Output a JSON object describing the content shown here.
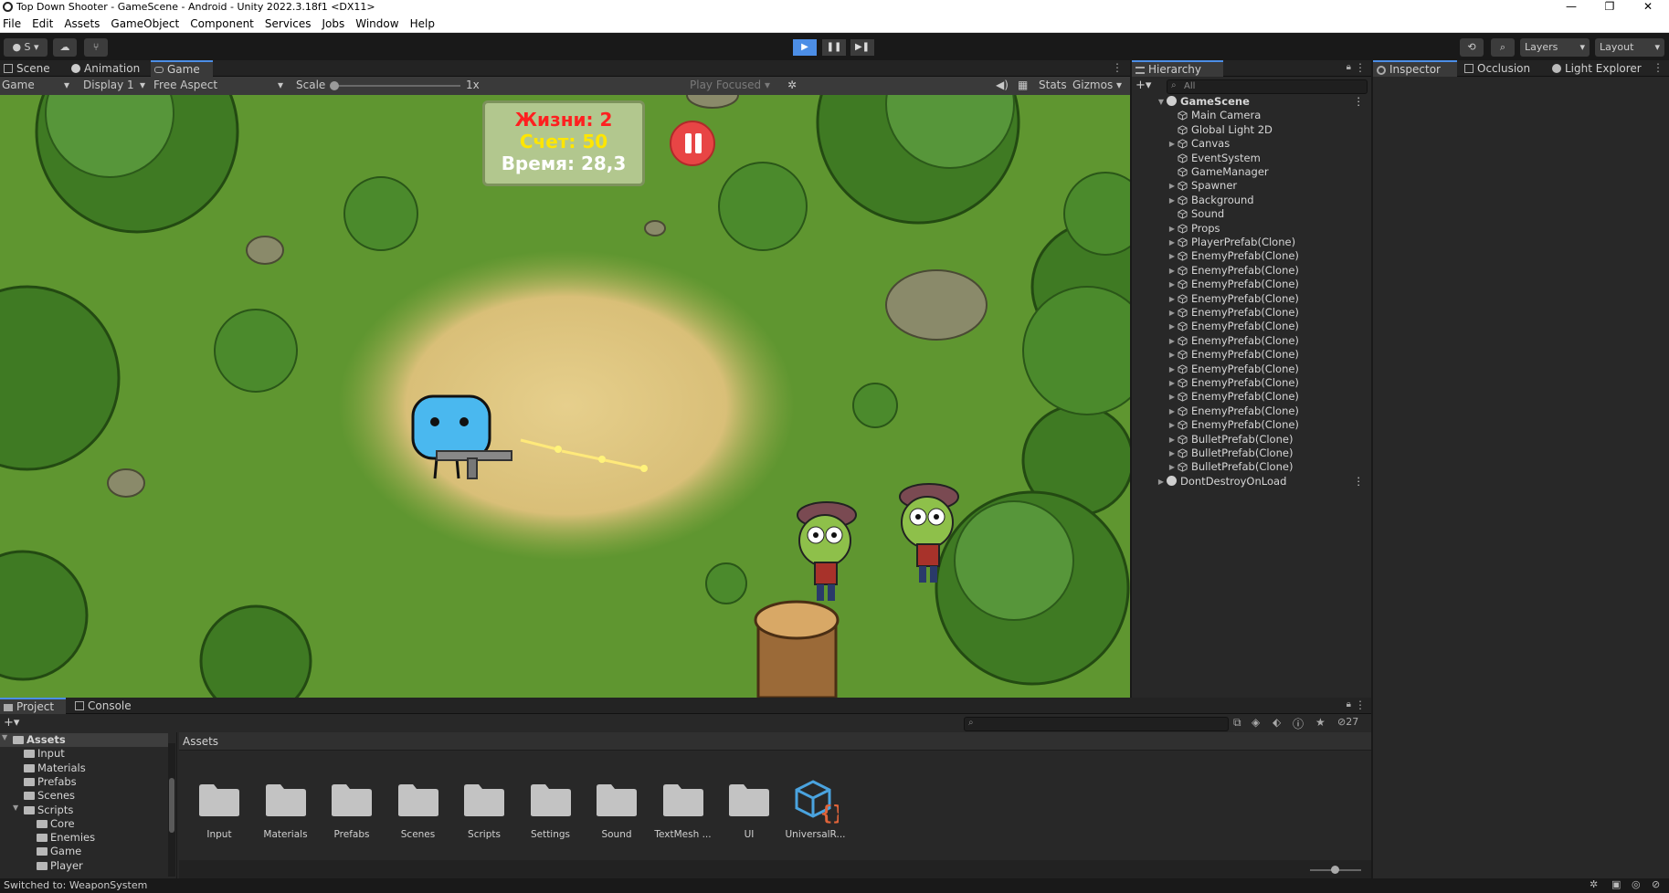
{
  "window": {
    "title": "Top Down Shooter - GameScene - Android - Unity 2022.3.18f1 <DX11>",
    "controls": [
      "—",
      "❐",
      "✕"
    ]
  },
  "menu": [
    "File",
    "Edit",
    "Assets",
    "GameObject",
    "Component",
    "Services",
    "Jobs",
    "Window",
    "Help"
  ],
  "toolbar": {
    "account_label": "S",
    "layers_label": "Layers",
    "layout_label": "Layout"
  },
  "scene_tabs": [
    "Scene",
    "Animation",
    "Game"
  ],
  "game_bar": {
    "mode": "Game",
    "display": "Display 1",
    "aspect": "Free Aspect",
    "scale_label": "Scale",
    "scale_value": "1x",
    "play_focused": "Play Focused",
    "stats": "Stats",
    "gizmos": "Gizmos"
  },
  "hud": {
    "lives": "Жизни: 2",
    "score": "Счет: 50",
    "time": "Время: 28,3"
  },
  "hierarchy": {
    "tab": "Hierarchy",
    "search_placeholder": "All",
    "scene": "GameScene",
    "items": [
      {
        "label": "Main Camera",
        "expandable": false
      },
      {
        "label": "Global Light 2D",
        "expandable": false
      },
      {
        "label": "Canvas",
        "expandable": true
      },
      {
        "label": "EventSystem",
        "expandable": false
      },
      {
        "label": "GameManager",
        "expandable": false
      },
      {
        "label": "Spawner",
        "expandable": true
      },
      {
        "label": "Background",
        "expandable": true
      },
      {
        "label": "Sound",
        "expandable": false
      },
      {
        "label": "Props",
        "expandable": true
      },
      {
        "label": "PlayerPrefab(Clone)",
        "expandable": true
      },
      {
        "label": "EnemyPrefab(Clone)",
        "expandable": true
      },
      {
        "label": "EnemyPrefab(Clone)",
        "expandable": true
      },
      {
        "label": "EnemyPrefab(Clone)",
        "expandable": true
      },
      {
        "label": "EnemyPrefab(Clone)",
        "expandable": true
      },
      {
        "label": "EnemyPrefab(Clone)",
        "expandable": true
      },
      {
        "label": "EnemyPrefab(Clone)",
        "expandable": true
      },
      {
        "label": "EnemyPrefab(Clone)",
        "expandable": true
      },
      {
        "label": "EnemyPrefab(Clone)",
        "expandable": true
      },
      {
        "label": "EnemyPrefab(Clone)",
        "expandable": true
      },
      {
        "label": "EnemyPrefab(Clone)",
        "expandable": true
      },
      {
        "label": "EnemyPrefab(Clone)",
        "expandable": true
      },
      {
        "label": "EnemyPrefab(Clone)",
        "expandable": true
      },
      {
        "label": "EnemyPrefab(Clone)",
        "expandable": true
      },
      {
        "label": "BulletPrefab(Clone)",
        "expandable": true
      },
      {
        "label": "BulletPrefab(Clone)",
        "expandable": true
      },
      {
        "label": "BulletPrefab(Clone)",
        "expandable": true
      }
    ],
    "dont_destroy": "DontDestroyOnLoad"
  },
  "inspector_tabs": [
    "Inspector",
    "Occlusion",
    "Light Explorer"
  ],
  "project": {
    "tabs": [
      "Project",
      "Console"
    ],
    "breadcrumb": "Assets",
    "hidden_count": "27",
    "tree": [
      {
        "label": "Assets",
        "level": 0,
        "bold": true
      },
      {
        "label": "Input",
        "level": 1
      },
      {
        "label": "Materials",
        "level": 1
      },
      {
        "label": "Prefabs",
        "level": 1
      },
      {
        "label": "Scenes",
        "level": 1
      },
      {
        "label": "Scripts",
        "level": 1
      },
      {
        "label": "Core",
        "level": 2
      },
      {
        "label": "Enemies",
        "level": 2
      },
      {
        "label": "Game",
        "level": 2
      },
      {
        "label": "Player",
        "level": 2
      }
    ],
    "assets": [
      "Input",
      "Materials",
      "Prefabs",
      "Scenes",
      "Scripts",
      "Settings",
      "Sound",
      "TextMesh ...",
      "UI",
      "UniversalR..."
    ]
  },
  "status": {
    "message": "Switched to: WeaponSystem"
  },
  "colors": {
    "accent": "#4c8ee6",
    "lives": "#ff2020",
    "score": "#ffe600",
    "time": "#ffffff",
    "pause": "#e84545"
  }
}
